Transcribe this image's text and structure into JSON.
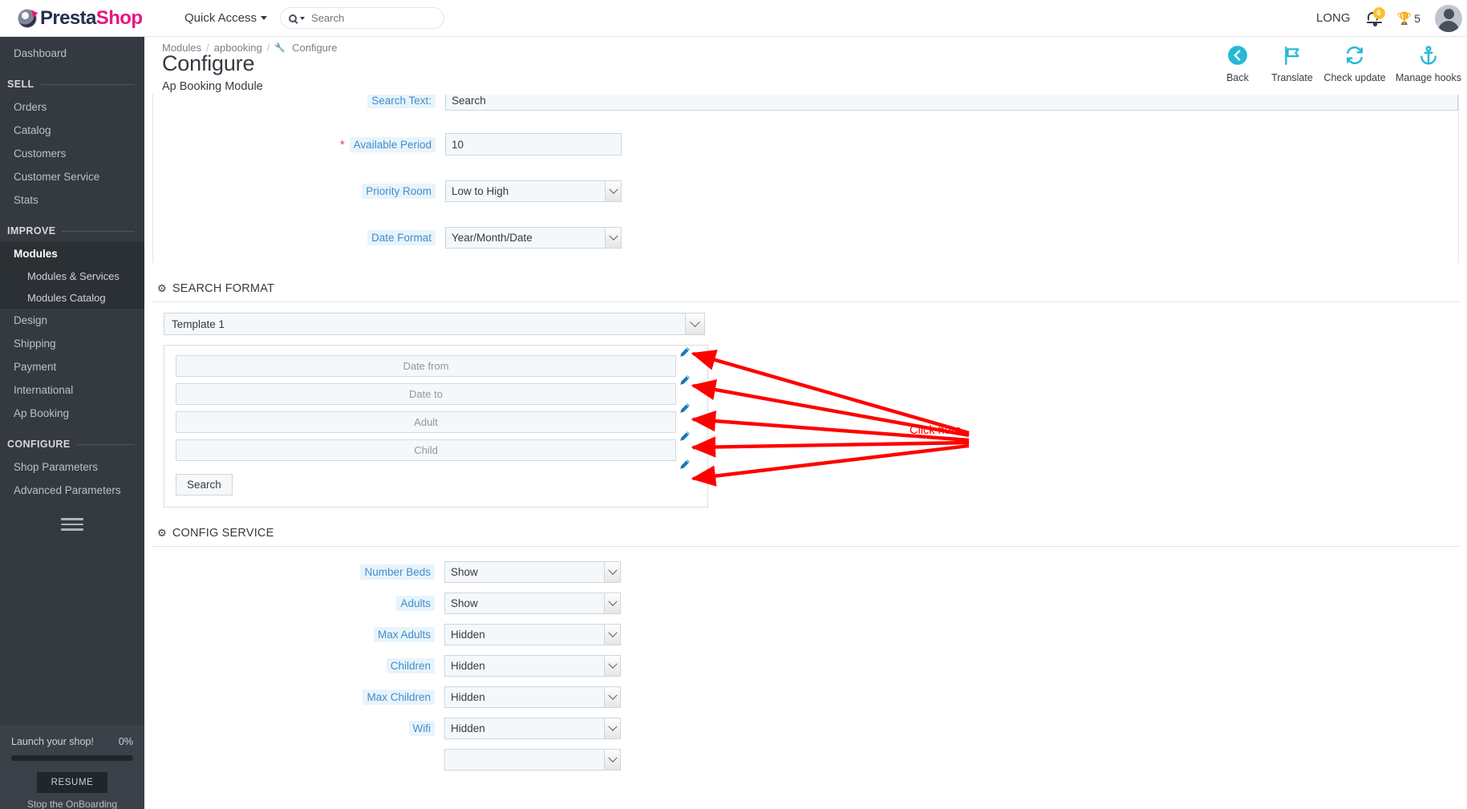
{
  "topbar": {
    "logo_primary": "Presta",
    "logo_secondary": "Shop",
    "quick_access_label": "Quick Access",
    "search_placeholder": "Search",
    "search_value": "",
    "employee_name": "LONG",
    "notification_count": "6",
    "trophy_count": "5",
    "icons": {
      "search": "search-icon",
      "bell": "bell-icon",
      "trophy": "trophy-icon",
      "avatar": "avatar-icon"
    }
  },
  "sidebar": {
    "dashboard": "Dashboard",
    "sections": [
      {
        "title": "SELL",
        "items": [
          "Orders",
          "Catalog",
          "Customers",
          "Customer Service",
          "Stats"
        ]
      },
      {
        "title": "IMPROVE",
        "items": [
          "Modules",
          "Design",
          "Shipping",
          "Payment",
          "International",
          "Ap Booking"
        ],
        "active_item": "Modules",
        "sub_items": [
          "Modules & Services",
          "Modules Catalog"
        ]
      },
      {
        "title": "CONFIGURE",
        "items": [
          "Shop Parameters",
          "Advanced Parameters"
        ]
      }
    ],
    "onboarding": {
      "title": "Launch your shop!",
      "percent": "0%",
      "resume_label": "RESUME",
      "stop_label": "Stop the OnBoarding"
    }
  },
  "page": {
    "breadcrumb": [
      "Modules",
      "apbooking",
      "Configure"
    ],
    "title": "Configure",
    "subtitle": "Ap Booking Module",
    "toolbar": [
      {
        "label": "Back",
        "icon": "back-arrow-icon"
      },
      {
        "label": "Translate",
        "icon": "flag-icon"
      },
      {
        "label": "Check update",
        "icon": "refresh-icon"
      },
      {
        "label": "Manage hooks",
        "icon": "anchor-icon"
      }
    ]
  },
  "settings_form": {
    "rows": [
      {
        "label": "Search Text:",
        "value": "Search",
        "type": "text",
        "required": false,
        "width": "wide"
      },
      {
        "label": "Available Period",
        "value": "10",
        "type": "text",
        "required": true,
        "width": "narrow"
      },
      {
        "label": "Priority Room",
        "value": "Low to High",
        "type": "select",
        "required": false
      },
      {
        "label": "Date Format",
        "value": "Year/Month/Date",
        "type": "select",
        "required": false
      }
    ]
  },
  "search_format": {
    "section_title": "SEARCH FORMAT",
    "template_value": "Template 1",
    "preview_fields": [
      "Date from",
      "Date to",
      "Adult",
      "Child"
    ],
    "search_button_label": "Search",
    "edit_icon": "pencil-icon"
  },
  "config_service": {
    "section_title": "CONFIG SERVICE",
    "rows": [
      {
        "label": "Number Beds",
        "value": "Show"
      },
      {
        "label": "Adults",
        "value": "Show"
      },
      {
        "label": "Max Adults",
        "value": "Hidden"
      },
      {
        "label": "Children",
        "value": "Hidden"
      },
      {
        "label": "Max Children",
        "value": "Hidden"
      },
      {
        "label": "Wifi",
        "value": "Hidden"
      }
    ]
  },
  "annotation": {
    "text": "Click here",
    "color": "#ff0000"
  },
  "colors": {
    "sidebar_bg": "#343a40",
    "accent": "#25b9d7",
    "brand_pink": "#e6177e",
    "label_bg": "#e8f4fb",
    "label_text": "#3f8ecb",
    "input_bg": "#f4f8fa",
    "required": "#e8453c"
  }
}
